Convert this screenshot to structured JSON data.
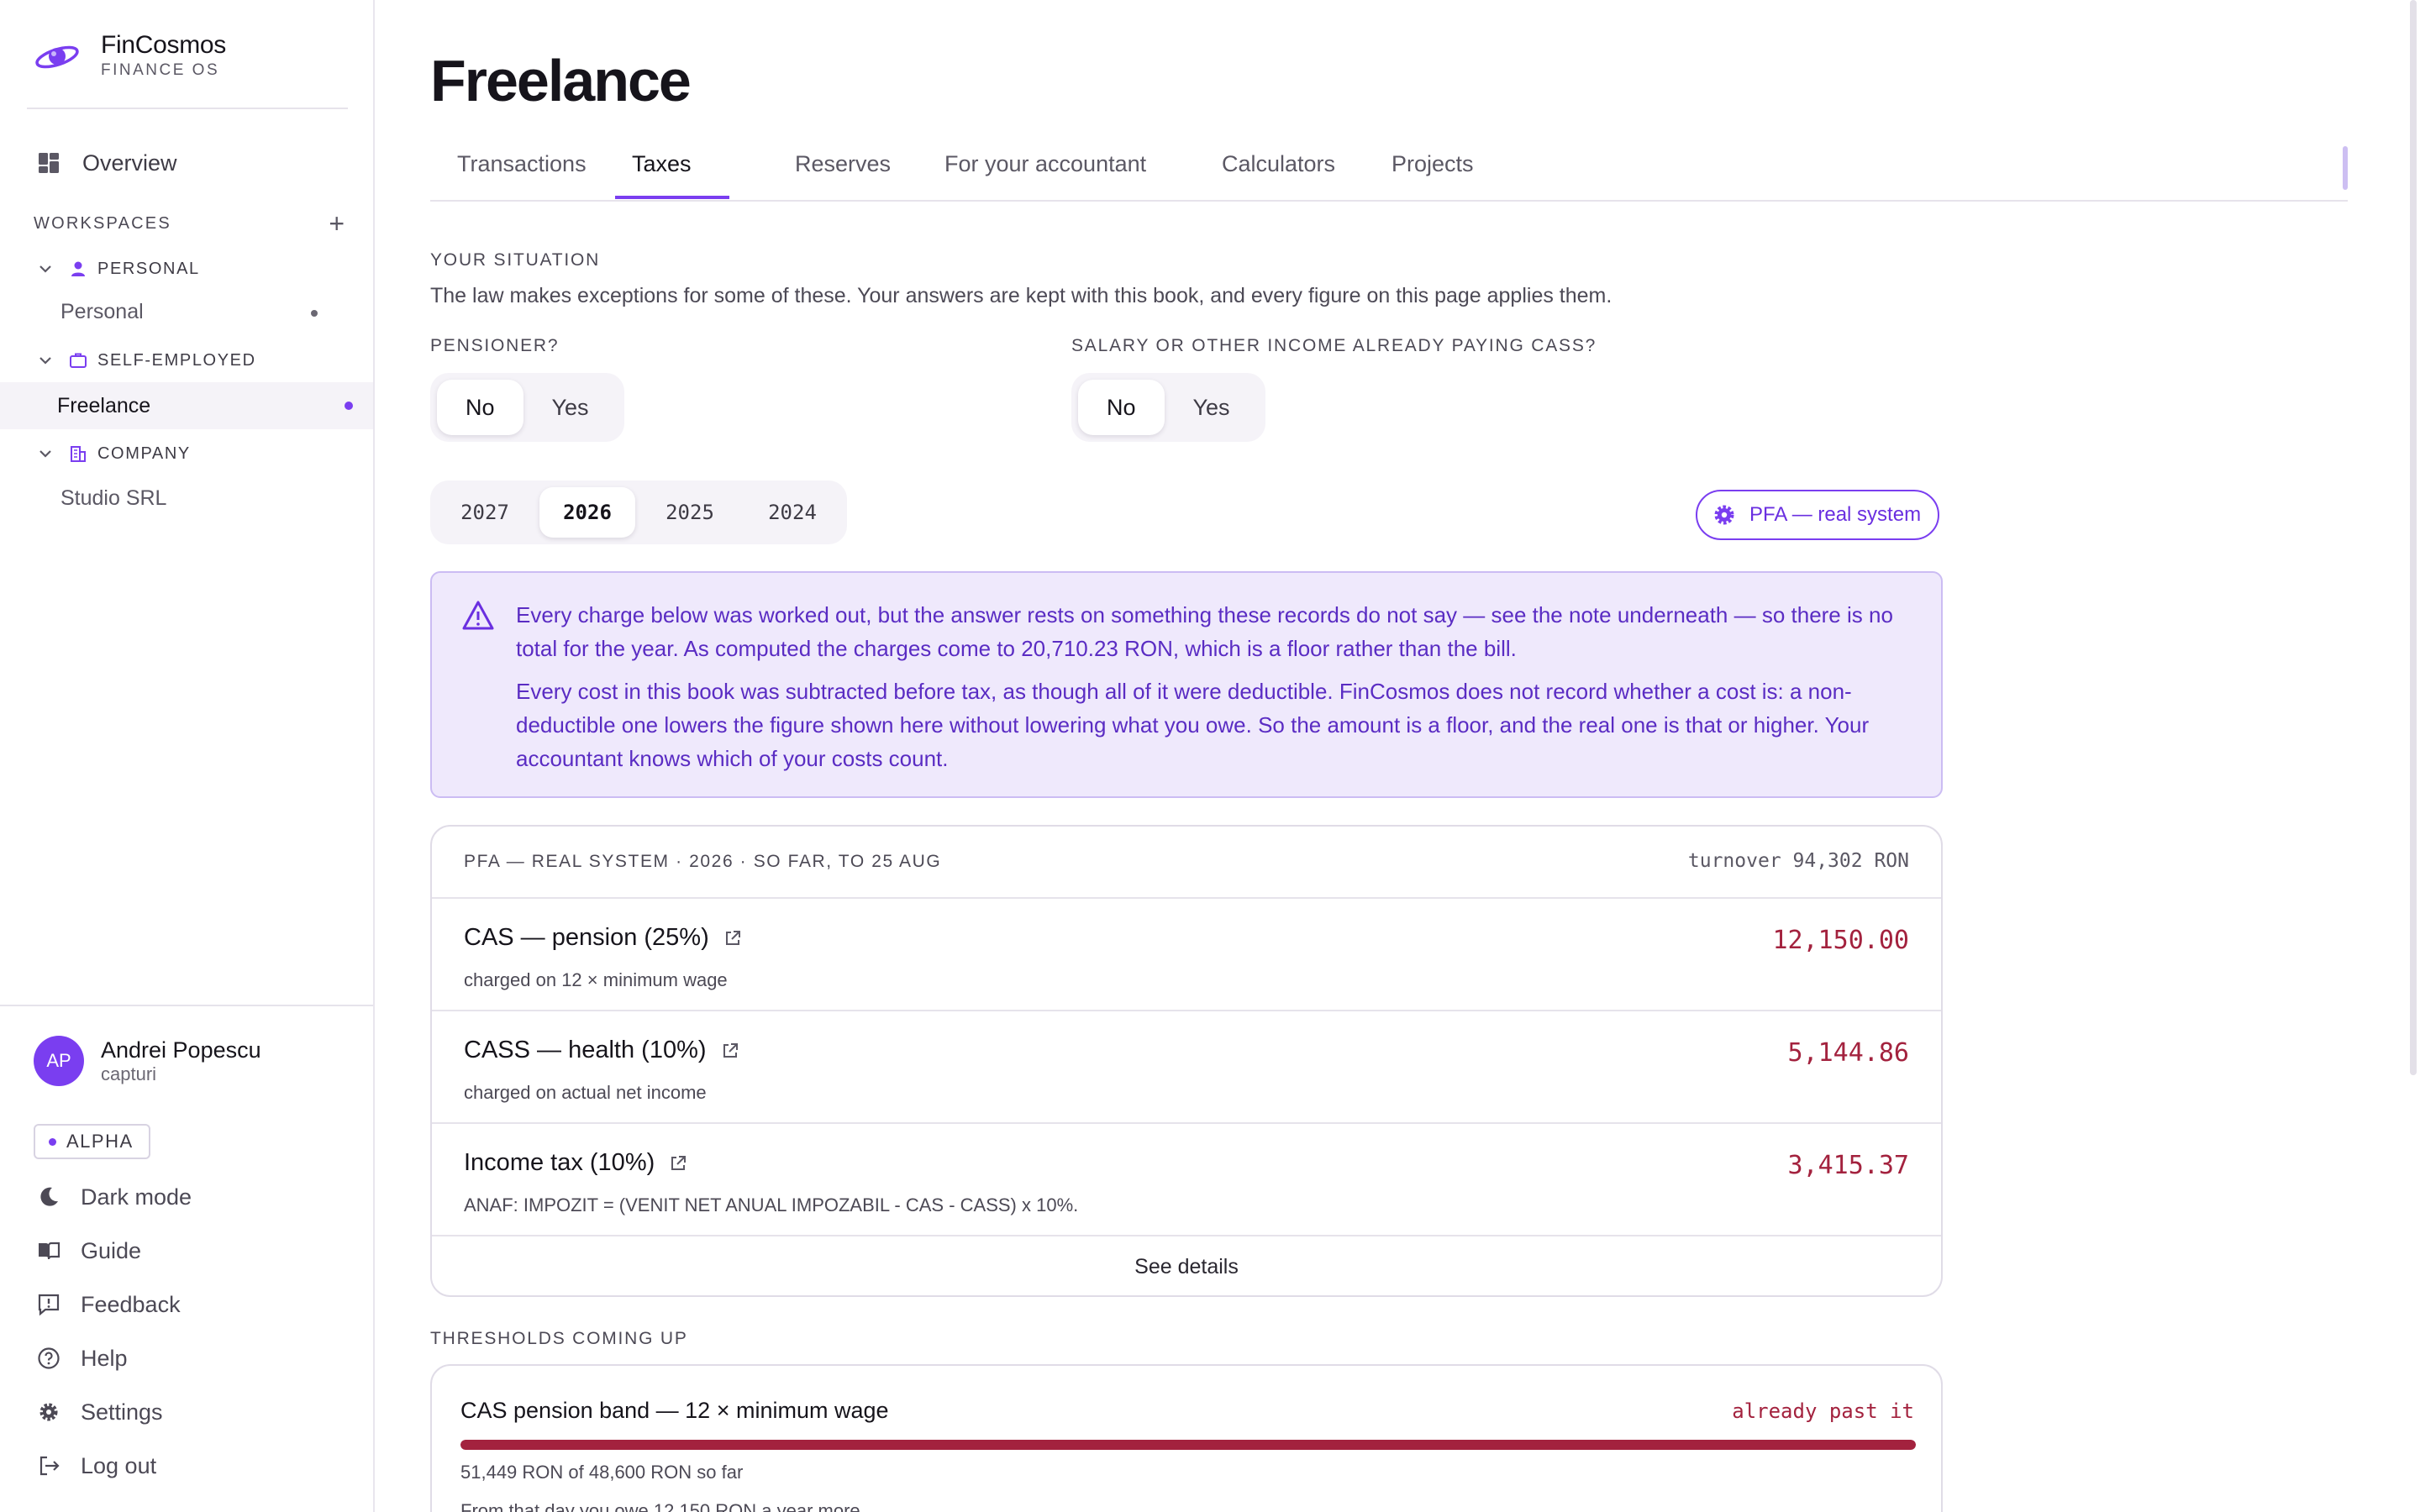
{
  "brand": {
    "name": "FinCosmos",
    "subtitle": "FINANCE OS"
  },
  "sidebar": {
    "overview_label": "Overview",
    "workspaces_label": "WORKSPACES",
    "add_symbol": "+",
    "groups": [
      {
        "label": "PERSONAL",
        "items": [
          {
            "label": "Personal",
            "active": false
          }
        ]
      },
      {
        "label": "SELF-EMPLOYED",
        "items": [
          {
            "label": "Freelance",
            "active": true
          }
        ]
      },
      {
        "label": "COMPANY",
        "items": [
          {
            "label": "Studio SRL",
            "active": false
          }
        ]
      }
    ],
    "user": {
      "initials": "AP",
      "name": "Andrei Popescu",
      "handle": "capturi"
    },
    "badge": "ALPHA",
    "footer": {
      "dark_mode": "Dark mode",
      "guide": "Guide",
      "feedback": "Feedback",
      "help": "Help",
      "settings": "Settings",
      "logout": "Log out"
    }
  },
  "page": {
    "title": "Freelance"
  },
  "tabs": [
    "Transactions",
    "Taxes",
    "Reserves",
    "For your accountant",
    "Calculators",
    "Projects"
  ],
  "active_tab": "Taxes",
  "situation": {
    "label": "YOUR SITUATION",
    "intro": "The law makes exceptions for some of these. Your answers are kept with this book, and every figure on this page applies them.",
    "pensioner": {
      "label": "PENSIONER?",
      "options": [
        "No",
        "Yes"
      ],
      "selected": "No"
    },
    "salary_cass": {
      "label": "SALARY OR OTHER INCOME ALREADY PAYING CASS?",
      "options": [
        "No",
        "Yes"
      ],
      "selected": "No"
    }
  },
  "years": {
    "options": [
      "2027",
      "2026",
      "2025",
      "2024"
    ],
    "selected": "2026"
  },
  "regime_button": "PFA — real system",
  "warning": {
    "p1": "Every charge below was worked out, but the answer rests on something these records do not say — see the note underneath — so there is no total for the year. As computed the charges come to 20,710.23 RON, which is a floor rather than the bill.",
    "p2": "Every cost in this book was subtracted before tax, as though all of it were deductible. FinCosmos does not record whether a cost is: a non-deductible one lowers the figure shown here without lowering what you owe. So the amount is a floor, and the real one is that or higher. Your accountant knows which of your costs count."
  },
  "charges": {
    "header": "PFA — REAL SYSTEM · 2026 · SO FAR, TO 25 AUG",
    "turnover": "turnover 94,302 RON",
    "rows": [
      {
        "title": "CAS — pension (25%)",
        "subtitle": "charged on 12 × minimum wage",
        "amount": "12,150.00"
      },
      {
        "title": "CASS — health (10%)",
        "subtitle": "charged on actual net income",
        "amount": "5,144.86"
      },
      {
        "title": "Income tax (10%)",
        "subtitle": "ANAF: IMPOZIT = (VENIT NET ANUAL IMPOZABIL - CAS - CASS) x 10%.",
        "amount": "3,415.37"
      }
    ],
    "details_label": "See details"
  },
  "thresholds": {
    "label": "THRESHOLDS COMING UP",
    "item": {
      "title": "CAS pension band — 12 × minimum wage",
      "status": "already past it",
      "progress": 1.0,
      "line1": "51,449 RON of 48,600 RON so far",
      "line2": "From that day you owe 12,150 RON a year more"
    }
  },
  "colors": {
    "accent": "#7a3ef0",
    "negative": "#a3223e",
    "warning_bg": "#efe9fc"
  }
}
